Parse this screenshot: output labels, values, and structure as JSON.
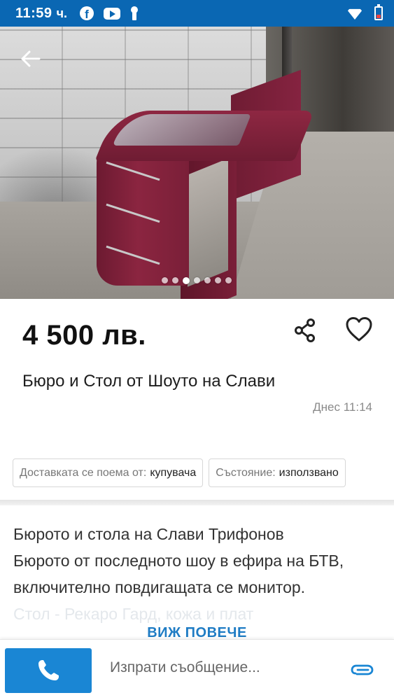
{
  "status_bar": {
    "time": "11:59",
    "time_suffix": "ч.",
    "icons": [
      "facebook-icon",
      "youtube-icon",
      "keyhole-icon",
      "wifi-icon",
      "battery-icon"
    ],
    "background_color": "#0a67b3"
  },
  "gallery": {
    "image_count": 7,
    "active_index": 2,
    "back_icon": "back-arrow-icon"
  },
  "listing": {
    "price": "4 500 лв.",
    "title": "Бюро и Стол от Шоуто на Слави",
    "date": "Днес 11:14",
    "share_icon": "share-icon",
    "favorite_icon": "heart-icon"
  },
  "chips": [
    {
      "label": "Доставката се поема от:",
      "value": "купувача"
    },
    {
      "label": "Състояние:",
      "value": "използвано"
    }
  ],
  "description": {
    "lines": [
      "Бюрото и стола на Слави Трифонов",
      "Бюрото от последното шоу в ефира на БТВ,",
      "включително повдигащата се монитор.",
      "Стол - Рекаро Гард, кожа и плат"
    ],
    "show_more_label": "ВИЖ ПОВЕЧЕ"
  },
  "bottom_bar": {
    "call_icon": "phone-icon",
    "message_placeholder": "Изпрати съобщение...",
    "attach_icon": "paperclip-icon",
    "accent_color": "#1a86d4"
  }
}
